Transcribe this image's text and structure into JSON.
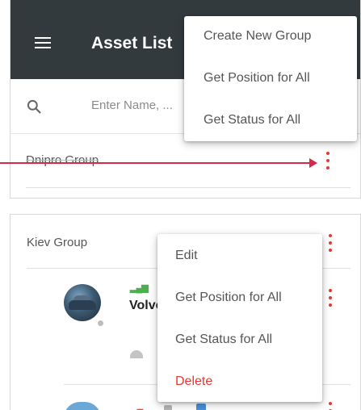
{
  "app": {
    "title": "Asset List",
    "menu_icon": "hamburger-icon"
  },
  "search": {
    "icon": "search-icon",
    "placeholder": "Enter Name, ..."
  },
  "groups": [
    {
      "name": "Dnipro Group",
      "more_icon": "more-vert-icon"
    },
    {
      "name": "Kiev Group",
      "more_icon": "more-vert-icon"
    }
  ],
  "assets": [
    {
      "name": "Volvo",
      "signal_icon": "signal-icon",
      "status_icon": "speed-icon"
    },
    {
      "name": "",
      "signal_icon": "signal-icon"
    }
  ],
  "top_menu": {
    "items": [
      "Create New Group",
      "Get Position for All",
      "Get Status for All"
    ]
  },
  "group_menu": {
    "items": [
      "Edit",
      "Get Position for All",
      "Get Status for All",
      "Delete"
    ]
  },
  "colors": {
    "appbar": "#323a3e",
    "accent_red": "#e53935",
    "annotation_arrow": "#d6284a",
    "signal_green": "#4caf50"
  }
}
